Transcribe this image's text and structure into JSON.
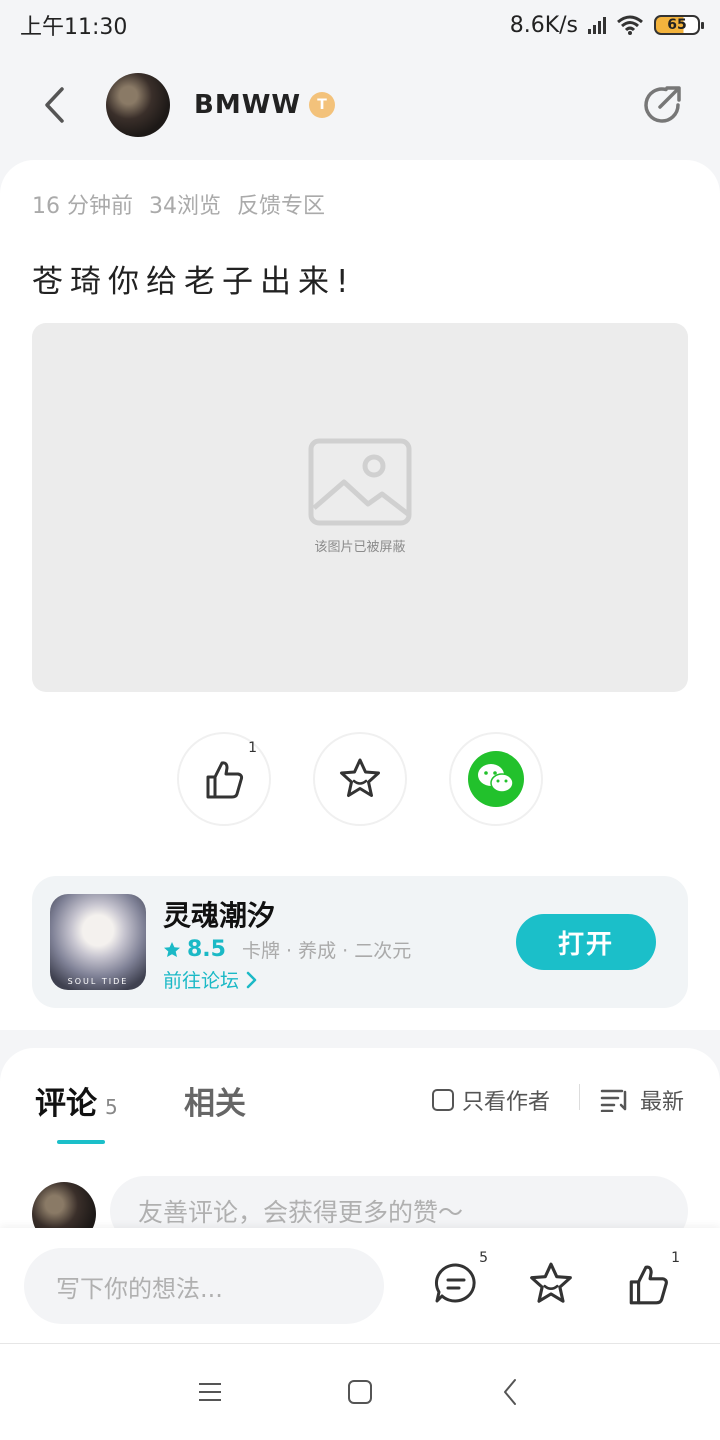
{
  "status_bar": {
    "time": "上午11:30",
    "network_speed": "8.6K/s",
    "battery": "65",
    "icons": [
      "signal-icon",
      "wifi-icon",
      "battery-icon"
    ]
  },
  "header": {
    "username": "BMWW",
    "badge_text": "T",
    "icons": [
      "back-arrow-icon",
      "share-icon"
    ]
  },
  "post": {
    "time_ago": "16 分钟前",
    "views": "34浏览",
    "category": "反馈专区",
    "title": "苍琦你给老子出来!",
    "image_caption": "该图片已被屏蔽",
    "like_count": "1"
  },
  "game": {
    "name": "灵魂潮汐",
    "rating": "8.5",
    "tags": "卡牌 · 养成 · 二次元",
    "forum_link": "前往论坛",
    "open_label": "打开",
    "icon_text": "SOUL TIDE"
  },
  "comments": {
    "tab_comments": "评论",
    "comment_count": "5",
    "tab_related": "相关",
    "author_only": "只看作者",
    "sort_label": "最新",
    "prompt": "友善评论，会获得更多的赞～"
  },
  "bottom_bar": {
    "placeholder": "写下你的想法...",
    "comment_count": "5",
    "like_count": "1"
  },
  "colors": {
    "accent": "#1bbfc9",
    "wechat": "#22c12c",
    "background": "#f4f5f7"
  }
}
